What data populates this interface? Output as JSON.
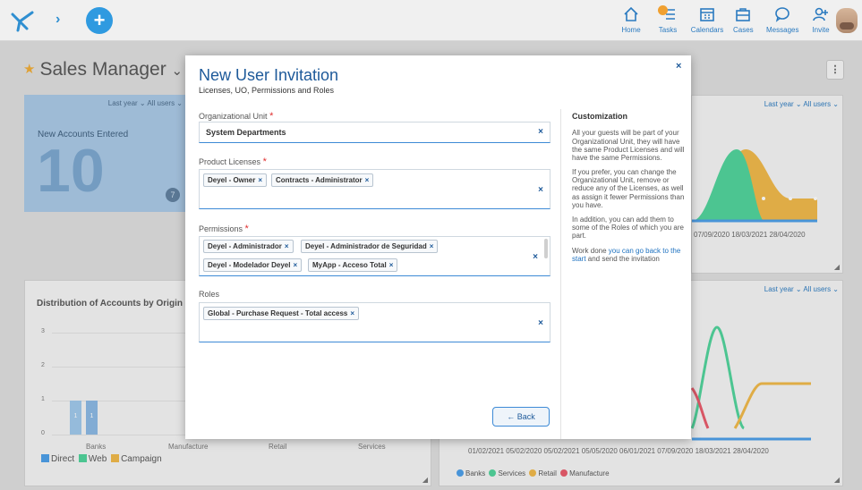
{
  "topbar": {
    "nav": [
      {
        "label": "Home",
        "icon": "home-icon"
      },
      {
        "label": "Tasks",
        "icon": "tasks-icon"
      },
      {
        "label": "Calendars",
        "icon": "calendar-icon"
      },
      {
        "label": "Cases",
        "icon": "briefcase-icon"
      },
      {
        "label": "Messages",
        "icon": "message-icon"
      },
      {
        "label": "Invite",
        "icon": "invite-icon"
      }
    ]
  },
  "page": {
    "title": "Sales Manager",
    "title_caret": "⌄"
  },
  "accounts_widget": {
    "filter": "Last year ⌄ All users ⌄",
    "label": "New Accounts Entered",
    "value": "10"
  },
  "right_widget_top": {
    "filter": "Last year ⌄ All users ⌄",
    "x_labels": "07/09/2020   18/03/2021   28/04/2020"
  },
  "distribution_widget": {
    "title": "Distribution of Accounts by Origin",
    "y_ticks": [
      "3",
      "2",
      "1",
      "0"
    ],
    "categories": [
      "Banks",
      "Manufacture",
      "Retail",
      "Services"
    ],
    "bar_labels": [
      "1",
      "1"
    ],
    "legend": [
      {
        "label": "Direct",
        "color": "#4a9ee8"
      },
      {
        "label": "Web",
        "color": "#4fd39a"
      },
      {
        "label": "Campaign",
        "color": "#f0b848"
      }
    ]
  },
  "right_widget_bottom": {
    "filter": "Last year ⌄ All users ⌄",
    "x_labels": "01/02/2021   05/02/2020   05/02/2021   05/05/2020   06/01/2021   07/09/2020   18/03/2021   28/04/2020",
    "legend": [
      {
        "label": "Banks",
        "color": "#4a9ee8"
      },
      {
        "label": "Services",
        "color": "#4fd39a"
      },
      {
        "label": "Retail",
        "color": "#f0b848"
      },
      {
        "label": "Manufacture",
        "color": "#e85a6a"
      }
    ]
  },
  "modal": {
    "title": "New User Invitation",
    "subtitle": "Licenses, UO, Permissions and Roles",
    "close": "×",
    "org_unit": {
      "label": "Organizational Unit",
      "value": "System Departments"
    },
    "licenses": {
      "label": "Product Licenses",
      "tags": [
        "Deyel - Owner",
        "Contracts - Administrator"
      ]
    },
    "permissions": {
      "label": "Permissions",
      "tags": [
        "Deyel - Administrador",
        "Deyel - Administrador de Seguridad",
        "Deyel - Modelador Deyel",
        "MyApp - Acceso Total"
      ]
    },
    "roles": {
      "label": "Roles",
      "tags": [
        "Global - Purchase Request - Total access"
      ]
    },
    "back_label": "← Back",
    "side": {
      "heading": "Customization",
      "p1": "All your guests will be part of your Organizational Unit, they will have the same Product Licenses and will have the same Permissions.",
      "p2": "If you prefer, you can change the Organizational Unit, remove or reduce any of the Licenses, as well as assign it fewer Permissions than you have.",
      "p3": "In addition, you can add them to some of the Roles of which you are part.",
      "p4_prefix": "Work done ",
      "p4_link": "you can go back to the start",
      "p4_suffix": " and send the invitation"
    }
  }
}
